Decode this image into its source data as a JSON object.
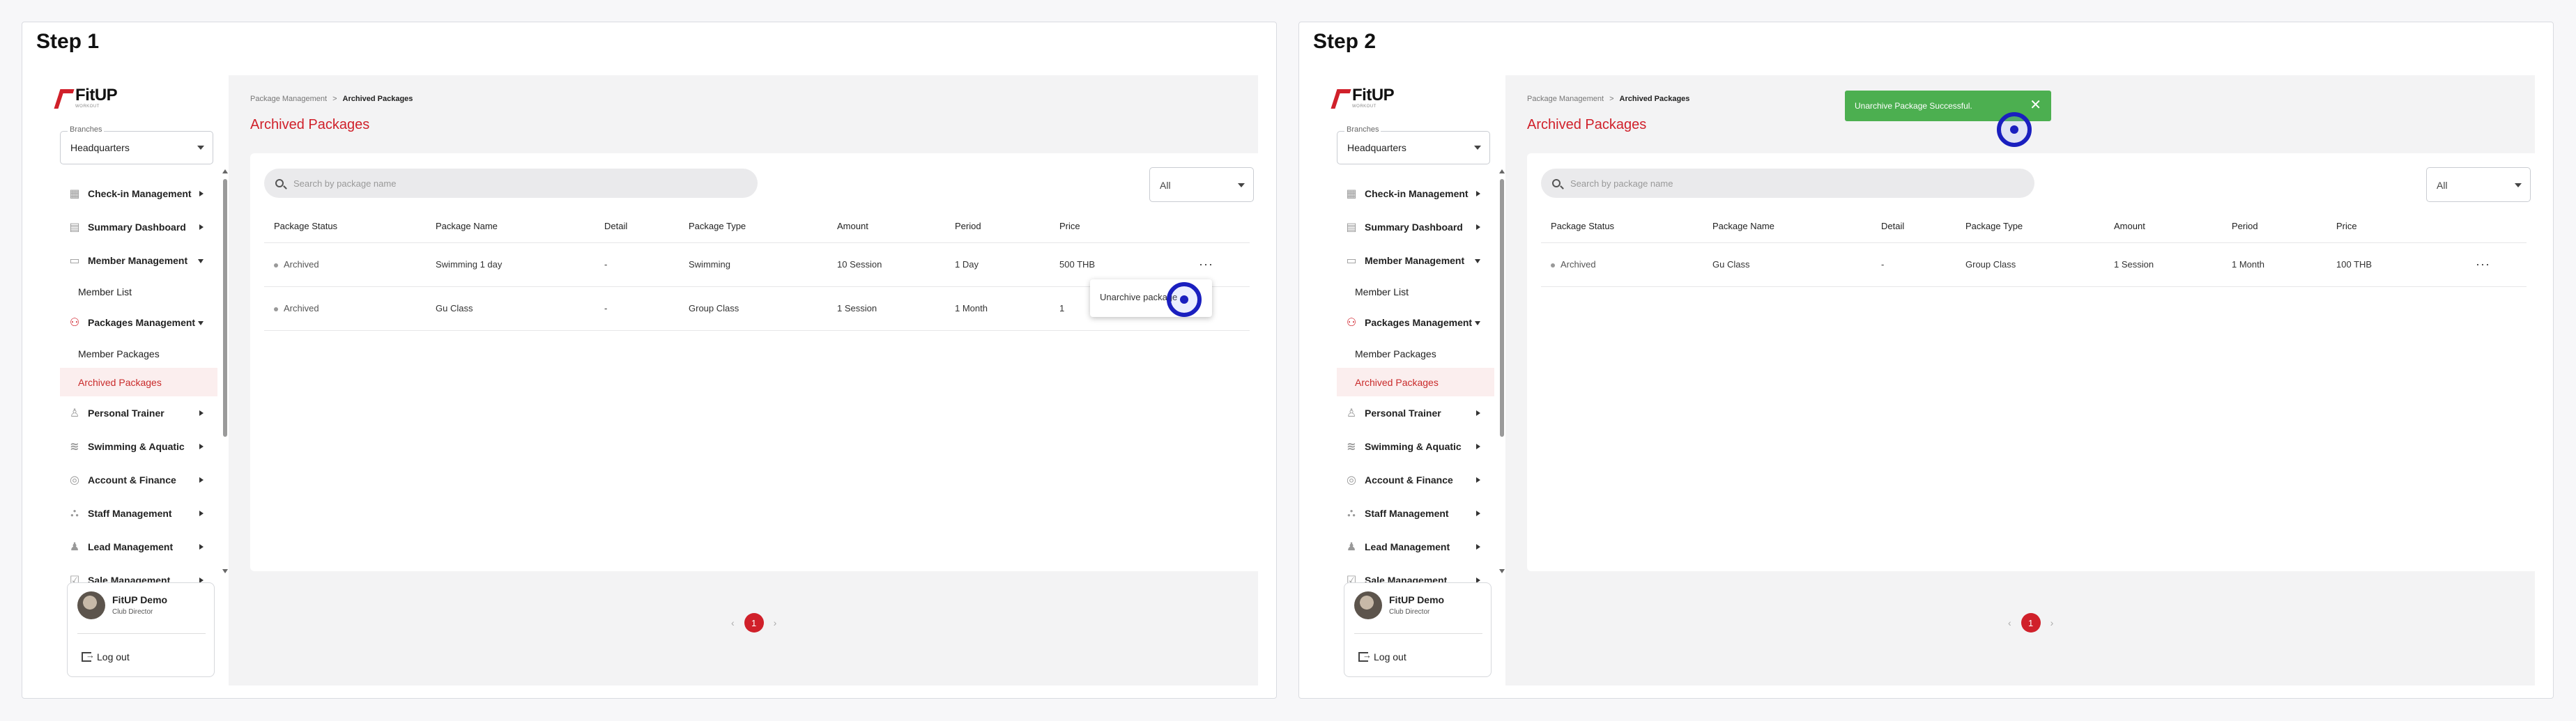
{
  "steps": [
    {
      "title": "Step 1",
      "brand": {
        "name": "FitUP",
        "sub": "WORKOUT"
      },
      "branch": {
        "label": "Branches",
        "value": "Headquarters"
      },
      "nav": {
        "checkin": "Check-in Management",
        "summary": "Summary Dashboard",
        "member": "Member Management",
        "member_list": "Member List",
        "packages": "Packages Management",
        "member_packages": "Member Packages",
        "archived_packages": "Archived Packages",
        "personal_trainer": "Personal Trainer",
        "swimming": "Swimming & Aquatic",
        "account": "Account & Finance",
        "staff": "Staff Management",
        "lead": "Lead Management",
        "sale": "Sale Management"
      },
      "user": {
        "name": "FitUP Demo",
        "role": "Club Director",
        "logout": "Log out"
      },
      "breadcrumb": {
        "parent": "Package Management",
        "sep": ">",
        "current": "Archived Packages"
      },
      "page_title": "Archived Packages",
      "search_placeholder": "Search by package name",
      "filter_value": "All",
      "columns": [
        "Package Status",
        "Package Name",
        "Detail",
        "Package Type",
        "Amount",
        "Period",
        "Price"
      ],
      "rows": [
        {
          "status": "Archived",
          "name": "Swimming 1 day",
          "detail": "-",
          "type": "Swimming",
          "amount": "10 Session",
          "period": "1 Day",
          "price": "500 THB",
          "more": "···"
        },
        {
          "status": "Archived",
          "name": "Gu Class",
          "detail": "-",
          "type": "Group Class",
          "amount": "1 Session",
          "period": "1 Month",
          "price": "1",
          "more": ""
        }
      ],
      "menu_item": "Unarchive package",
      "pager": {
        "prev": "‹",
        "page": "1",
        "next": "›"
      }
    },
    {
      "title": "Step 2",
      "brand": {
        "name": "FitUP",
        "sub": "WORKOUT"
      },
      "branch": {
        "label": "Branches",
        "value": "Headquarters"
      },
      "nav": {
        "checkin": "Check-in Management",
        "summary": "Summary Dashboard",
        "member": "Member Management",
        "member_list": "Member List",
        "packages": "Packages Management",
        "member_packages": "Member Packages",
        "archived_packages": "Archived Packages",
        "personal_trainer": "Personal Trainer",
        "swimming": "Swimming & Aquatic",
        "account": "Account & Finance",
        "staff": "Staff Management",
        "lead": "Lead Management",
        "sale": "Sale Management"
      },
      "user": {
        "name": "FitUP Demo",
        "role": "Club Director",
        "logout": "Log out"
      },
      "breadcrumb": {
        "parent": "Package Management",
        "sep": ">",
        "current": "Archived Packages"
      },
      "page_title": "Archived Packages",
      "search_placeholder": "Search by package name",
      "filter_value": "All",
      "columns": [
        "Package Status",
        "Package Name",
        "Detail",
        "Package Type",
        "Amount",
        "Period",
        "Price"
      ],
      "rows": [
        {
          "status": "Archived",
          "name": "Gu Class",
          "detail": "-",
          "type": "Group Class",
          "amount": "1 Session",
          "period": "1 Month",
          "price": "100 THB",
          "more": "···"
        }
      ],
      "toast": {
        "message": "Unarchive Package Successful.",
        "close": "✕"
      },
      "pager": {
        "prev": "‹",
        "page": "1",
        "next": "›"
      }
    }
  ],
  "colors": {
    "brand_red": "#d0202a",
    "toast_green": "#4caf50",
    "click_marker": "#1a1fbf"
  },
  "icons": [
    "search-icon",
    "chevron-down-icon",
    "more-horizontal-icon",
    "close-icon",
    "logout-icon"
  ]
}
